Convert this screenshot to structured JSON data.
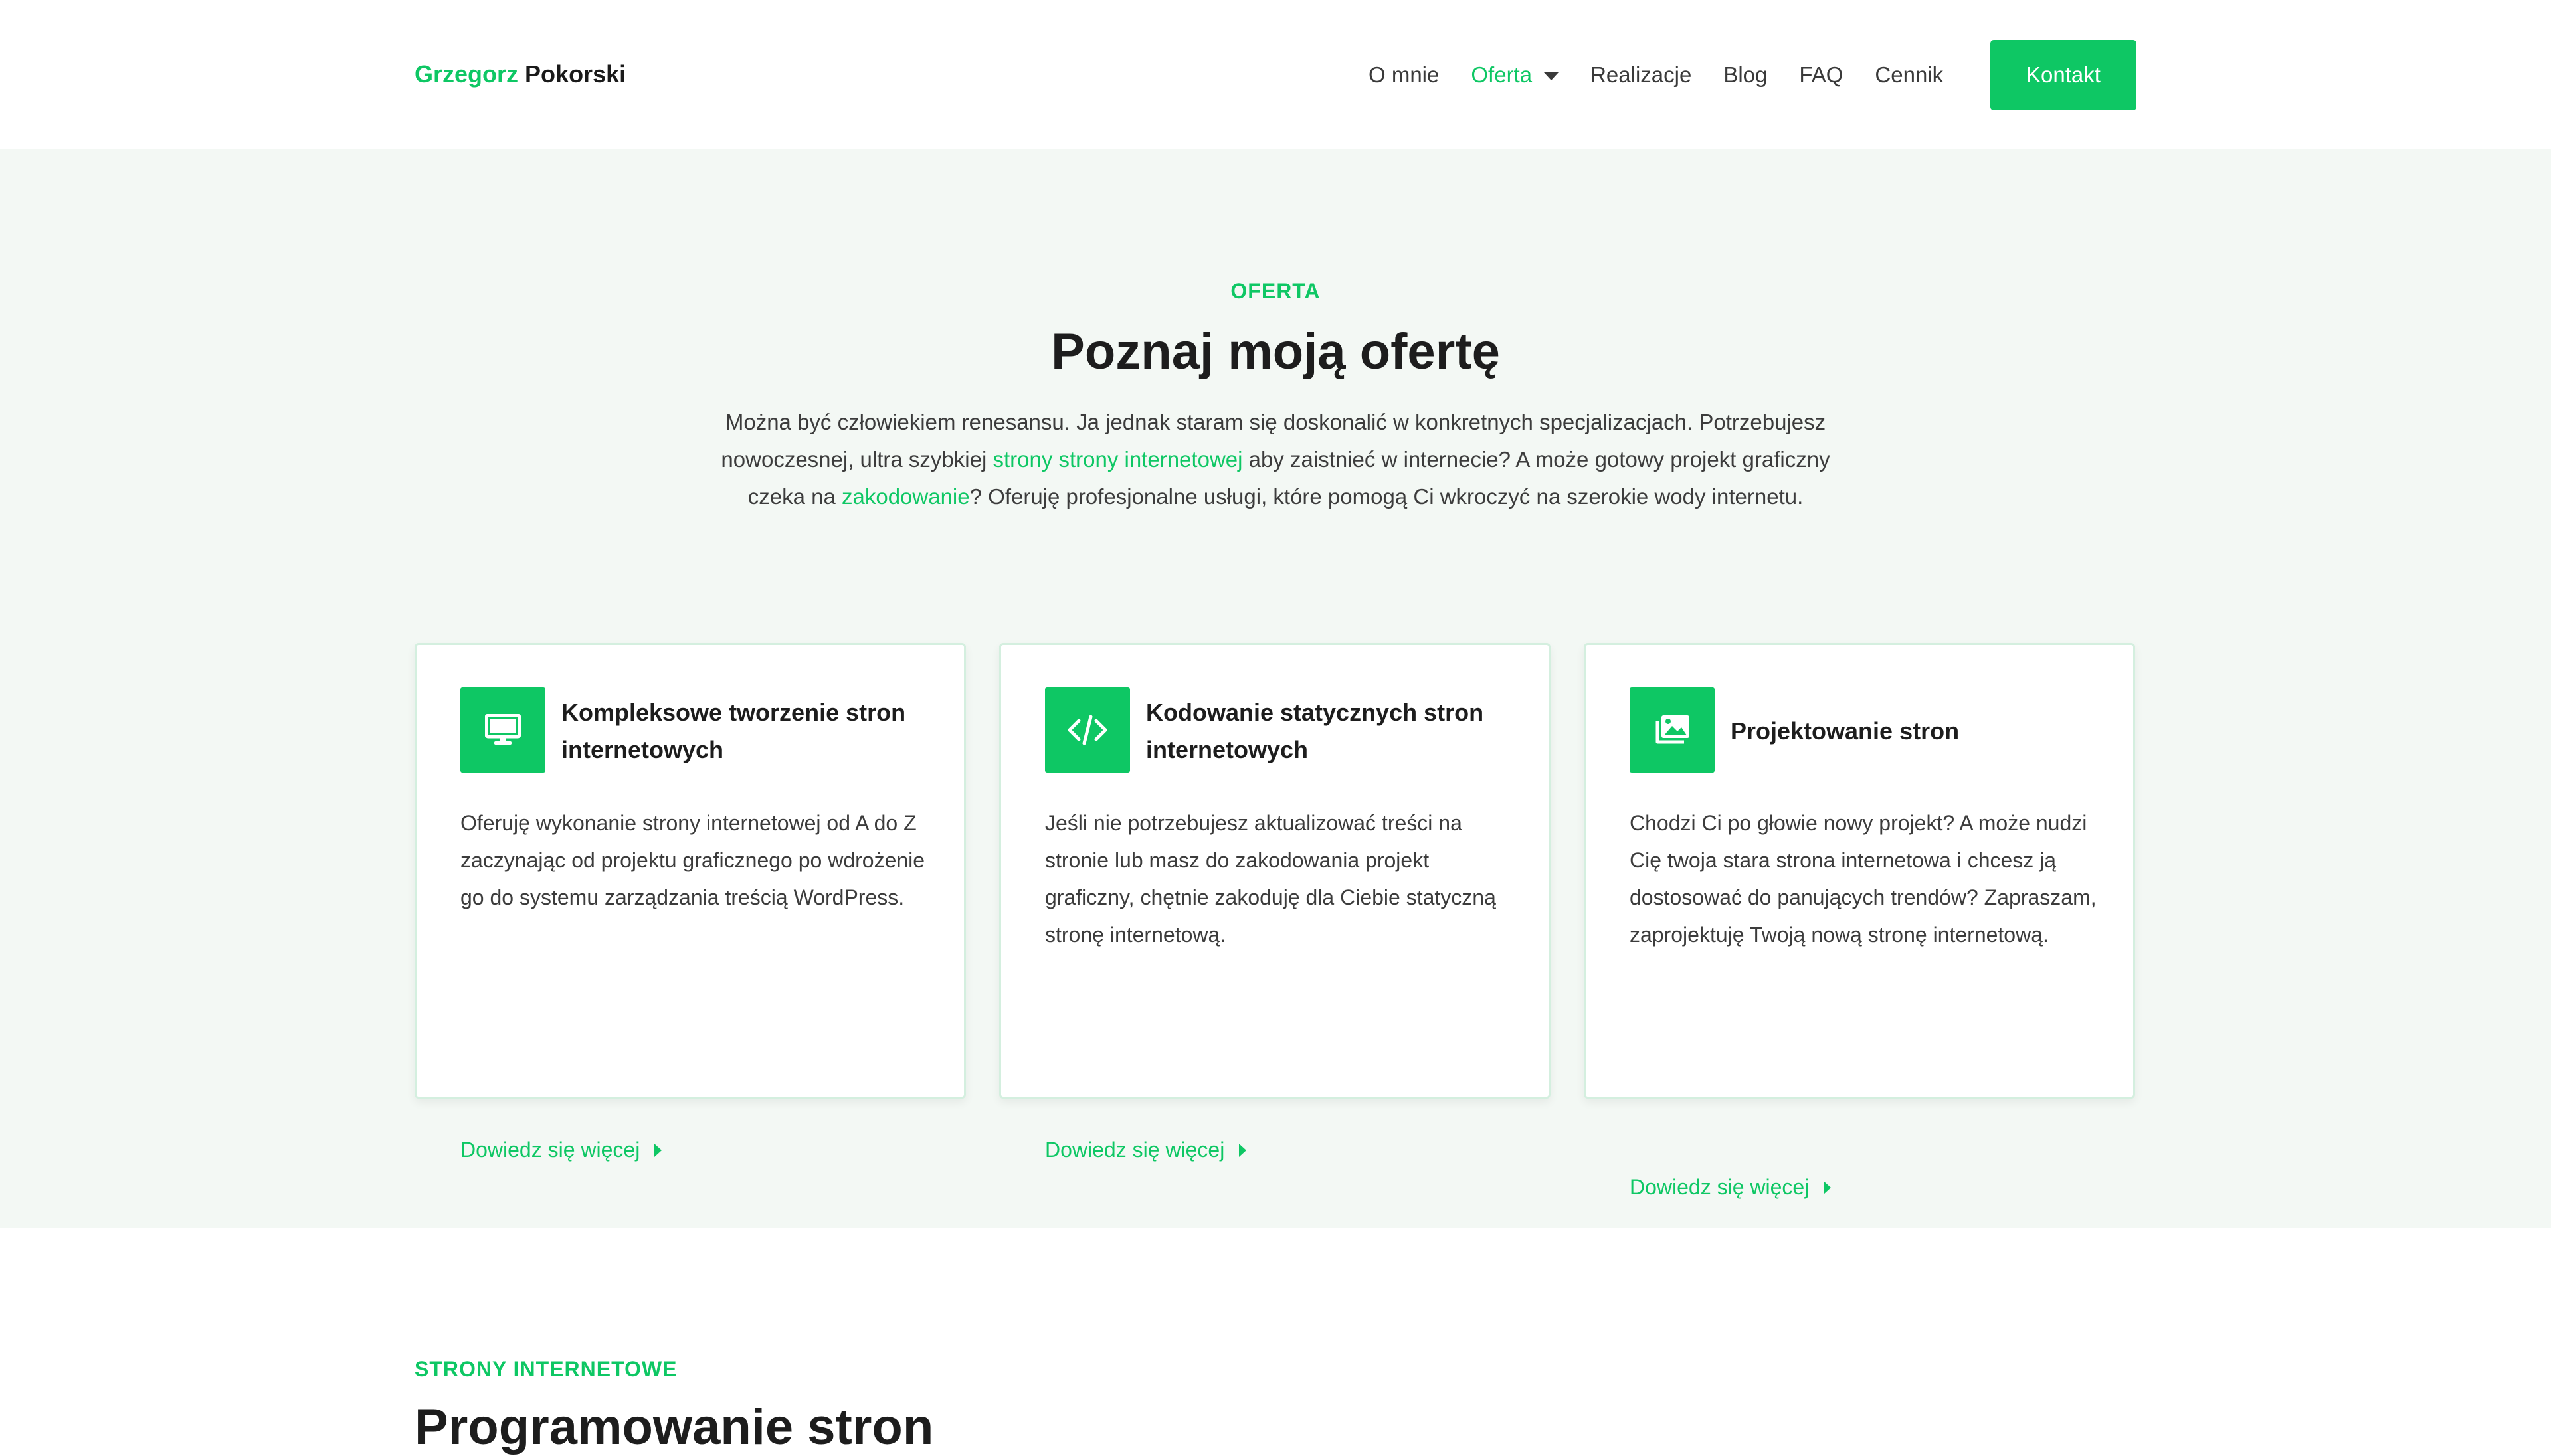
{
  "header": {
    "logo_first": "Grzegorz",
    "logo_last": "Pokorski",
    "nav": [
      {
        "label": "O mnie",
        "active": false
      },
      {
        "label": "Oferta",
        "active": true,
        "dropdown": true
      },
      {
        "label": "Realizacje",
        "active": false
      },
      {
        "label": "Blog",
        "active": false
      },
      {
        "label": "FAQ",
        "active": false
      },
      {
        "label": "Cennik",
        "active": false
      }
    ],
    "contact_label": "Kontakt"
  },
  "offer": {
    "eyebrow": "OFERTA",
    "title": "Poznaj moją ofertę",
    "intro": {
      "part1": "Można być człowiekiem renesansu. Ja jednak staram się doskonalić w konkretnych specjalizacjach. Potrzebujesz nowoczesnej, ultra szybkiej ",
      "link1": "strony strony internetowej",
      "part2": " aby zaistnieć w internecie? A może gotowy projekt graficzny czeka na ",
      "link2": "zakodowanie",
      "part3": "? Oferuję profesjonalne usługi, które pomogą Ci wkroczyć na szerokie wody internetu."
    },
    "cards": [
      {
        "icon": "monitor-icon",
        "title": "Kompleksowe tworzenie stron internetowych",
        "text": "Oferuję wykonanie strony internetowej od A do Z zaczynając od projektu graficznego po wdrożenie go do systemu zarządzania treścią WordPress.",
        "link": "Dowiedz się więcej"
      },
      {
        "icon": "code-icon",
        "title": "Kodowanie statycznych stron internetowych",
        "text": "Jeśli nie potrzebujesz aktualizować treści na stronie lub masz do zakodowania projekt graficzny, chętnie zakoduję dla Ciebie statyczną stronę internetową.",
        "link": "Dowiedz się więcej"
      },
      {
        "icon": "images-icon",
        "title": "Projektowanie stron",
        "text": "Chodzi Ci po głowie nowy projekt? A może nudzi Cię twoja stara strona internetowa i chcesz ją dostosować do panujących trendów? Zapraszam, zaprojektuję Twoją nową stronę internetową.",
        "link": "Dowiedz się więcej"
      }
    ]
  },
  "next_section": {
    "eyebrow": "STRONY INTERNETOWE",
    "title": "Programowanie stron"
  },
  "colors": {
    "accent": "#0ec764",
    "section_bg": "#f3f8f4",
    "text": "#3c3c3c",
    "heading": "#1d1d1d"
  }
}
